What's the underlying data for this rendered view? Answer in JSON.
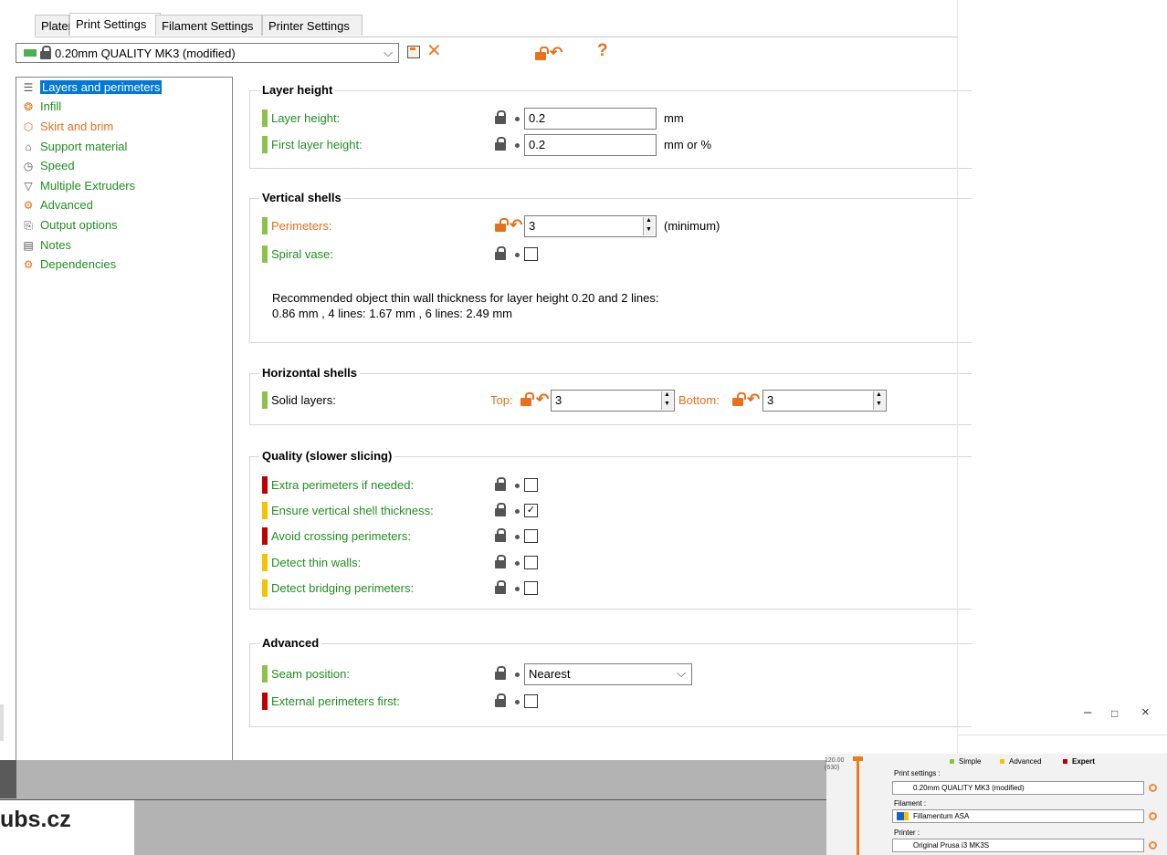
{
  "tabs": [
    "Plater",
    "Print Settings",
    "Filament Settings",
    "Printer Settings"
  ],
  "preset": {
    "name": "0.20mm QUALITY MK3 (modified)",
    "help": "?"
  },
  "sidebar": [
    {
      "label": "Layers and perimeters",
      "icon": "layers-icon"
    },
    {
      "label": "Infill",
      "icon": "infill-icon"
    },
    {
      "label": "Skirt and brim",
      "icon": "skirt-icon"
    },
    {
      "label": "Support material",
      "icon": "support-icon"
    },
    {
      "label": "Speed",
      "icon": "speed-icon"
    },
    {
      "label": "Multiple Extruders",
      "icon": "extruder-icon"
    },
    {
      "label": "Advanced",
      "icon": "advanced-icon"
    },
    {
      "label": "Output options",
      "icon": "output-icon"
    },
    {
      "label": "Notes",
      "icon": "notes-icon"
    },
    {
      "label": "Dependencies",
      "icon": "dependencies-icon"
    }
  ],
  "layer_height": {
    "title": "Layer height",
    "layer_height_label": "Layer height:",
    "layer_height_value": "0.2",
    "layer_height_unit": "mm",
    "first_layer_label": "First layer height:",
    "first_layer_value": "0.2",
    "first_layer_unit": "mm or %"
  },
  "vertical_shells": {
    "title": "Vertical shells",
    "perimeters_label": "Perimeters:",
    "perimeters_value": "3",
    "perimeters_unit": "(minimum)",
    "spiral_label": "Spiral vase:",
    "note_line1": "Recommended object thin wall thickness for layer height 0.20 and 2 lines:",
    "note_line2": "0.86 mm , 4 lines: 1.67 mm , 6 lines: 2.49 mm"
  },
  "horizontal_shells": {
    "title": "Horizontal shells",
    "solid_label": "Solid layers:",
    "top_label": "Top:",
    "top_value": "3",
    "bottom_label": "Bottom:",
    "bottom_value": "3"
  },
  "quality": {
    "title": "Quality (slower slicing)",
    "items": [
      {
        "label": "Extra perimeters if needed:",
        "checked": false
      },
      {
        "label": "Ensure vertical shell thickness:",
        "checked": true
      },
      {
        "label": "Avoid crossing perimeters:",
        "checked": false
      },
      {
        "label": "Detect thin walls:",
        "checked": false
      },
      {
        "label": "Detect bridging perimeters:",
        "checked": false
      }
    ]
  },
  "advanced": {
    "title": "Advanced",
    "seam_label": "Seam position:",
    "seam_value": "Nearest",
    "external_label": "External perimeters first:"
  },
  "bottom": {
    "brand": "ubs.cz",
    "slider_value": "120.00",
    "slider_sub": "(630)",
    "mode_simple": "Simple",
    "mode_advanced": "Advanced",
    "mode_expert": "Expert",
    "print_settings_label": "Print settings :",
    "print_settings_value": "0.20mm QUALITY MK3 (modified)",
    "filament_label": "Filament :",
    "filament_value": "Fillamentum ASA",
    "printer_label": "Printer :",
    "printer_value": "Original Prusa i3 MK3S"
  },
  "colors": {
    "simple": "#8bc34a",
    "advanced": "#f5c400",
    "expert": "#c00000",
    "modified": "#e8701a",
    "system": "#1f8f1f"
  }
}
